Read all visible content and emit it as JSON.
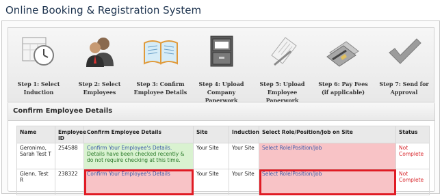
{
  "app_title": "Online Booking & Registration System",
  "steps": [
    {
      "line1": "Step 1: Select",
      "line2": "Induction",
      "icon": "clock-calendar-icon"
    },
    {
      "line1": "Step 2: Select",
      "line2": "Employees",
      "icon": "people-icon"
    },
    {
      "line1": "Step 3: Confirm",
      "line2": "Employee Details",
      "icon": "open-book-icon"
    },
    {
      "line1": "Step 4: Upload",
      "line2": "Company Paperwork",
      "icon": "filing-cabinet-icon"
    },
    {
      "line1": "Step 5: Upload",
      "line2": "Employee Paperwork",
      "icon": "document-pen-icon"
    },
    {
      "line1": "Step 6: Pay Fees",
      "line2": "(if applicable)",
      "icon": "credit-cards-icon"
    },
    {
      "line1": "Step 7: Send for",
      "line2": "Approval",
      "icon": "checkmark-icon"
    }
  ],
  "panel": {
    "title": "Confirm Employee Details"
  },
  "table": {
    "headers": [
      "Name",
      "Employee ID",
      "Confirm Employee Details",
      "Site",
      "Induction",
      "Select Role/Position/Job on Site",
      "Status"
    ],
    "rows": [
      {
        "name": "Geronimo, Sarah Test T",
        "id": "254588",
        "confirm_link": "Confirm Your Employee's Details.",
        "confirm_note": "Details have been checked recently & do not require checking at this time.",
        "site": "Your Site",
        "induction": "Your Site",
        "role": "Select Role/Position/Job",
        "status": "Not Complete"
      },
      {
        "name": "Glenn, Test R",
        "id": "238322",
        "confirm_link": "Confirm Your Employee's Details",
        "site": "Your Site",
        "induction": "Your Site",
        "role": "Select Role/Position/Job",
        "status": "Not Complete"
      }
    ]
  },
  "colors": {
    "highlight": "#e01b24",
    "status_red": "#d8262b",
    "link_blue": "#3b5aa8",
    "green_cell": "#d9f2d0",
    "pink_cell": "#f8c3c6"
  }
}
